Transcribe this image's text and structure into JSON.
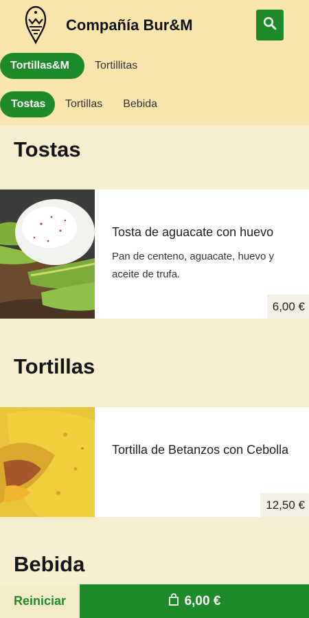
{
  "header": {
    "brand": "Compañía Bur&M",
    "logo_icon": "eagle-logo-icon",
    "search_icon": "search-icon"
  },
  "tabs_primary": [
    {
      "label": "Tortillas&M",
      "active": true
    },
    {
      "label": "Tortillitas",
      "active": false
    }
  ],
  "tabs_secondary": [
    {
      "label": "Tostas",
      "active": true
    },
    {
      "label": "Tortillas",
      "active": false
    },
    {
      "label": "Bebida",
      "active": false
    }
  ],
  "sections": [
    {
      "title": "Tostas",
      "items": [
        {
          "name": "Tosta de aguacate con huevo",
          "description": "Pan de centeno, aguacate, huevo y aceite de trufa.",
          "price": "6,00 €"
        }
      ]
    },
    {
      "title": "Tortillas",
      "items": [
        {
          "name": "Tortilla de Betanzos con Cebolla",
          "description": "",
          "price": "12,50 €"
        }
      ]
    },
    {
      "title": "Bebida",
      "items": []
    }
  ],
  "footer": {
    "reset_label": "Reiniciar",
    "cart_total": "6,00 €",
    "cart_icon": "shopping-bag-icon"
  },
  "colors": {
    "primary_green": "#1f8a2a",
    "header_bg": "#f8e6ad",
    "page_bg": "#f6efcf"
  }
}
